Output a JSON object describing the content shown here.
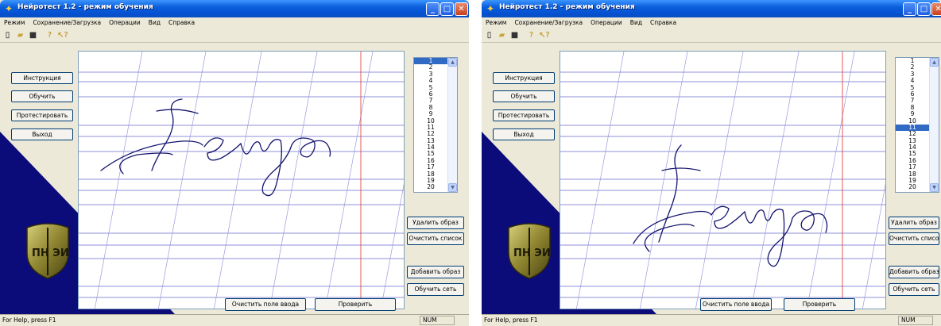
{
  "windows": [
    {
      "title": "Нейротест 1.2 - режим обучения",
      "menu": [
        "Режим",
        "Сохранение/Загрузка",
        "Операции",
        "Вид",
        "Справка"
      ],
      "left_buttons": [
        "Инструкция",
        "Обучить",
        "Протестировать",
        "Выход"
      ],
      "list_items": [
        "1",
        "2",
        "3",
        "4",
        "5",
        "6",
        "7",
        "8",
        "9",
        "10",
        "11",
        "12",
        "13",
        "14",
        "15",
        "16",
        "17",
        "18",
        "19",
        "20"
      ],
      "selected_item": "1",
      "right_buttons": [
        "Удалить образ",
        "Очистить список",
        "Добавить образ",
        "Обучить сеть"
      ],
      "bottom_buttons": [
        "Очистить поле ввода",
        "Проверить"
      ],
      "status_text": "For Help, press F1",
      "status_num": "NUM",
      "logo_text": "ПН ЭИ"
    },
    {
      "title": "Нейротест 1.2 - режим обучения",
      "menu": [
        "Режим",
        "Сохранение/Загрузка",
        "Операции",
        "Вид",
        "Справка"
      ],
      "left_buttons": [
        "Инструкция",
        "Обучить",
        "Протестировать",
        "Выход"
      ],
      "list_items": [
        "1",
        "2",
        "3",
        "4",
        "5",
        "6",
        "7",
        "8",
        "9",
        "10",
        "11",
        "12",
        "13",
        "14",
        "15",
        "16",
        "17",
        "18",
        "19",
        "20"
      ],
      "selected_item": "11",
      "right_buttons": [
        "Удалить образ",
        "Очистить список",
        "Добавить образ",
        "Обучить сеть"
      ],
      "bottom_buttons": [
        "Очистить поле ввода",
        "Проверить"
      ],
      "status_text": "For Help, press F1",
      "status_num": "NUM",
      "logo_text": "ПН ЭИ"
    }
  ],
  "icons": {
    "app": "app-icon",
    "toolbar": [
      "new-document-icon",
      "open-folder-icon",
      "save-icon",
      "help-icon",
      "context-help-icon"
    ],
    "window_controls": [
      "minimize-icon",
      "maximize-icon",
      "close-icon"
    ]
  },
  "colors": {
    "titlebar": "#0a5fdd",
    "navy_background": "#0b0b7a",
    "list_selection": "#316ac5",
    "ruled_lines": "#6a6acc",
    "margin_line": "#e03030",
    "ink": "#14146e"
  }
}
